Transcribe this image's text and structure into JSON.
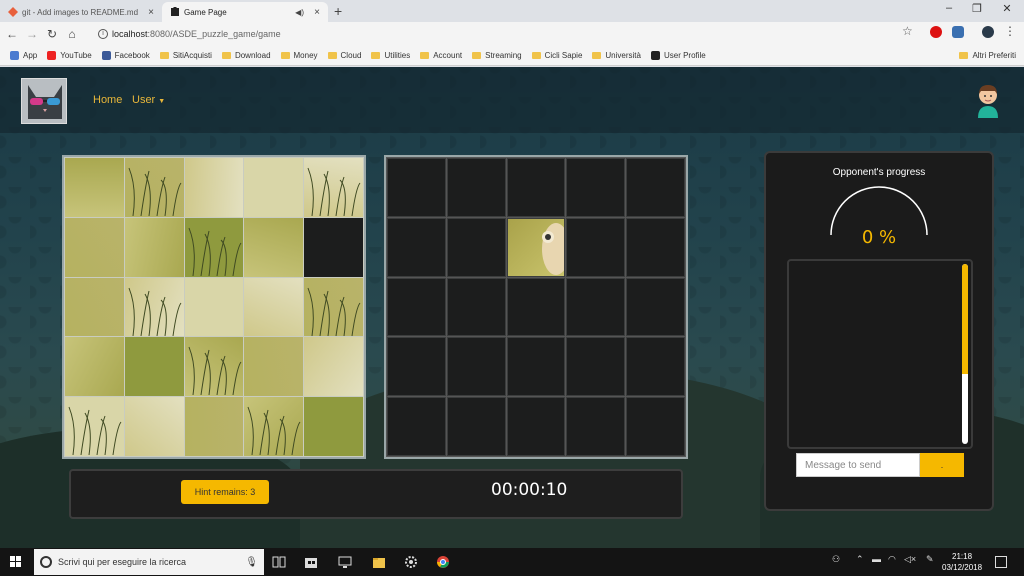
{
  "browser": {
    "tabs": [
      {
        "title": "git - Add images to README.md",
        "active": false
      },
      {
        "title": "Game Page",
        "active": true
      }
    ],
    "url_host": "localhost",
    "url_path": ":8080/ASDE_puzzle_game/game",
    "bookmarks": [
      "App",
      "YouTube",
      "Facebook",
      "SitiAcquisti",
      "Download",
      "Money",
      "Cloud",
      "Utilities",
      "Account",
      "Streaming",
      "Cicli Sapie",
      "Università",
      "User Profile"
    ],
    "other_bookmarks": "Altri Preferiti"
  },
  "nav": {
    "home": "Home",
    "user": "User"
  },
  "game": {
    "hint_label": "Hint remains: 3",
    "timer": "00:00:10",
    "board_size": 5,
    "left_board_empty": [
      [
        1,
        4
      ]
    ],
    "placed_pieces": [
      [
        1,
        2
      ]
    ]
  },
  "opponent": {
    "title": "Opponent's progress",
    "progress": "0 %",
    "progress_fraction": 0
  },
  "chat": {
    "placeholder": "Message to send",
    "send_label": "."
  },
  "taskbar": {
    "search_placeholder": "Scrivi qui per eseguire la ricerca",
    "time": "21:18",
    "date": "03/12/2018"
  },
  "colors": {
    "accent": "#f5b800",
    "nav_link": "#e8b73a"
  }
}
